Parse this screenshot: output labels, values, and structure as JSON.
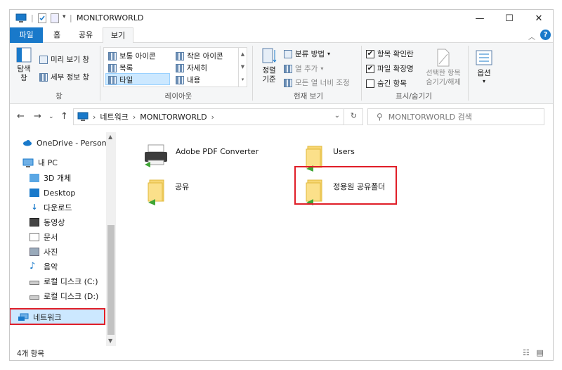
{
  "window": {
    "title": "MONLTORWORLD"
  },
  "window_controls": {
    "minimize": "—",
    "maximize": "☐",
    "close": "✕"
  },
  "ribbon_tabs": {
    "file": "파일",
    "home": "홈",
    "share": "공유",
    "view": "보기"
  },
  "ribbon": {
    "pane": {
      "nav_pane": "탐색\n창",
      "preview": "미리 보기 창",
      "details": "세부 정보 창",
      "group_label": "창"
    },
    "layout": {
      "items": [
        "보통 아이콘",
        "작은 아이콘",
        "목록",
        "자세히",
        "타일",
        "내용"
      ],
      "group_label": "레이아웃"
    },
    "current_view": {
      "sort": "정렬\n기준",
      "group_by": "분류 방법",
      "add_column": "열 추가",
      "fit_columns": "모든 열 너비 조정",
      "group_label": "현재 보기"
    },
    "show_hide": {
      "item_checkboxes": "항목 확인란",
      "file_ext": "파일 확장명",
      "hidden_items": "숨긴 항목",
      "hide_selected": "선택한 항목\n숨기기/해제",
      "group_label": "표시/숨기기"
    },
    "options": "옵션"
  },
  "address": {
    "segments": [
      "네트워크",
      "MONLTORWORLD"
    ],
    "search_placeholder": "MONLTORWORLD 검색"
  },
  "nav": {
    "onedrive": "OneDrive - Personal",
    "this_pc": "내 PC",
    "items": [
      "3D 개체",
      "Desktop",
      "다운로드",
      "동영상",
      "문서",
      "사진",
      "음악",
      "로컬 디스크 (C:)",
      "로컬 디스크 (D:)"
    ],
    "network": "네트워크"
  },
  "content": {
    "tiles": [
      "Adobe PDF Converter",
      "Users",
      "공유",
      "정용원 공유폴더"
    ]
  },
  "status": {
    "count": "4개 항목"
  },
  "colors": {
    "accent": "#1979ca",
    "highlight": "#e01e28",
    "selection": "#cce8ff",
    "folder": "#f7d674"
  }
}
